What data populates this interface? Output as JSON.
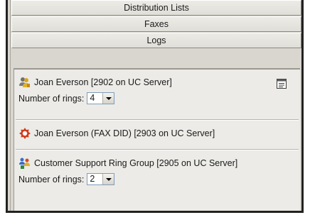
{
  "tabs": [
    {
      "label": "Distribution Lists"
    },
    {
      "label": "Faxes"
    },
    {
      "label": "Logs"
    }
  ],
  "items": [
    {
      "label": "Joan Everson [2902 on UC Server]",
      "icon": "user-group-icon",
      "rings_label": "Number of rings:",
      "rings_value": "4"
    },
    {
      "label": "Joan Everson (FAX DID) [2903 on UC Server]",
      "icon": "fax-did-icon"
    },
    {
      "label": "Customer Support Ring Group [2905 on UC Server]",
      "icon": "ring-group-icon",
      "rings_label": "Number of rings:",
      "rings_value": "2"
    }
  ],
  "colors": {
    "panel": "#ecebe7",
    "tab": "#e4e2dc",
    "select_border": "#7f9db9",
    "fax_icon": "#d23a1a"
  }
}
